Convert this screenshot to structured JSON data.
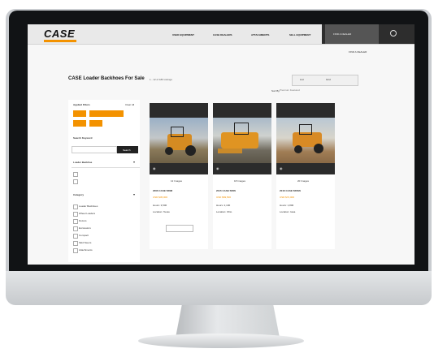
{
  "site": {
    "logo": "CASE",
    "nav": [
      "USED EQUIPMENT",
      "CASE DEALERS",
      "ATTACHMENTS",
      "SELL EQUIPMENT"
    ],
    "active_nav": "FIND A DEALER",
    "find_dealer": "FIND A DEALER"
  },
  "listing": {
    "title": "CASE Loader Backhoes For Sale",
    "count": "1 - 12 of 180 Listings",
    "view_options": [
      "List",
      "Grid"
    ],
    "sort_label": "Sort By",
    "sort_value": "Premium Featured"
  },
  "filters": {
    "header": "Applied Filters",
    "clear": "Clear All",
    "keyword_label": "Search Keyword",
    "search_button": "Search",
    "section_type": "Loader Backhoe",
    "section_category": "Category",
    "category_items": [
      "Loader Backhoes",
      "Wheel Loaders",
      "Dozers",
      "Excavators",
      "Compact",
      "Skid Steers",
      "Attachments"
    ]
  },
  "cards": [
    {
      "title": "2006 CASE 580M",
      "price": "USD $45,000",
      "hours": "Hours: 3,500",
      "location": "Location: Texas",
      "photos": "12 Images",
      "colors": [
        "#8a7a5a",
        "#d58b22"
      ]
    },
    {
      "title": "2015 CASE 580N",
      "price": "USD $69,500",
      "hours": "Hours: 2,100",
      "location": "Location: Ohio",
      "photos": "18 Images",
      "colors": [
        "#6f6a5e",
        "#e09422"
      ]
    },
    {
      "title": "2016 CASE 580SN",
      "price": "USD $72,000",
      "hours": "Hours: 1,800",
      "location": "Location: Iowa",
      "photos": "20 Images",
      "colors": [
        "#a07d55",
        "#d88a25"
      ]
    }
  ]
}
